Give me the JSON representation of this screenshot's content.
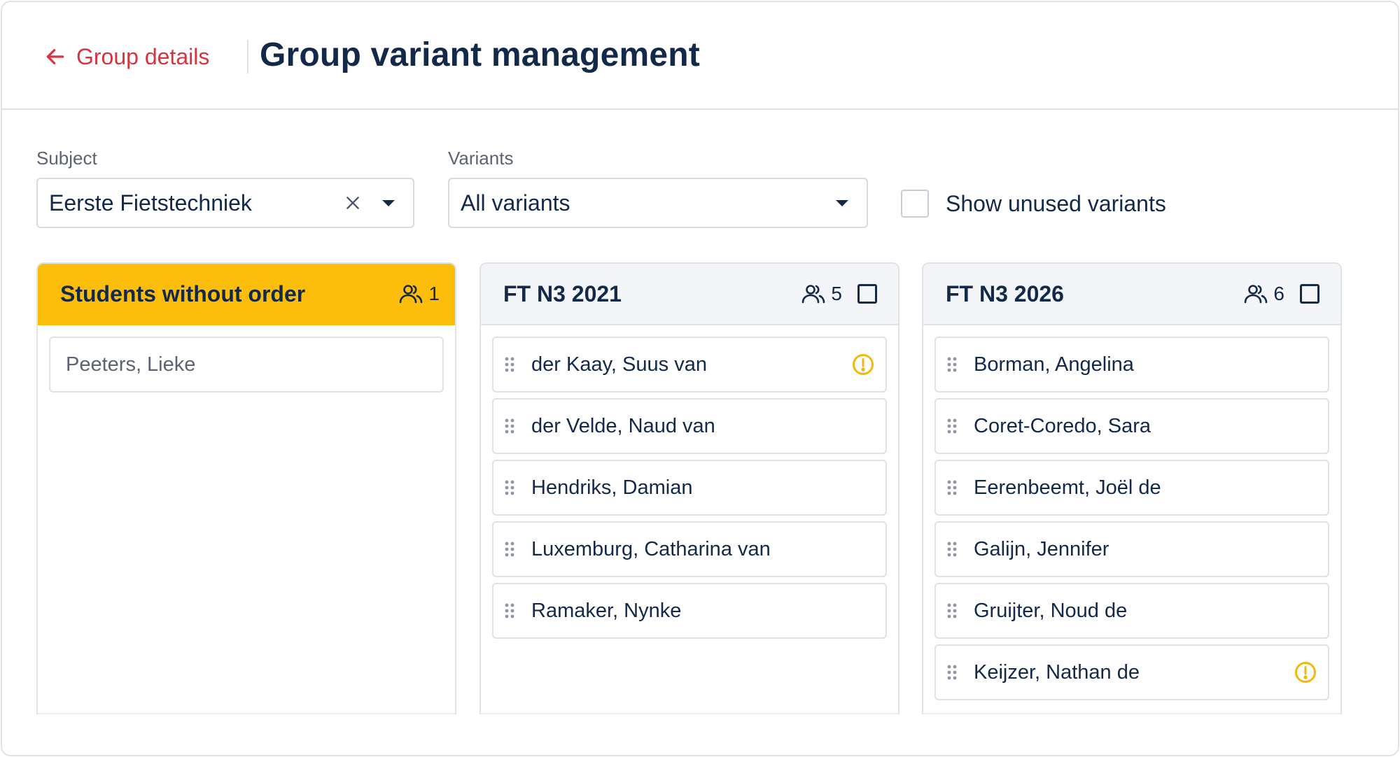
{
  "header": {
    "back_label": "Group details",
    "title": "Group variant management"
  },
  "filters": {
    "subject_label": "Subject",
    "subject_value": "Eerste Fietstechniek",
    "variants_label": "Variants",
    "variants_value": "All variants",
    "show_unused_label": "Show unused variants"
  },
  "columns": [
    {
      "title": "Students without order",
      "count": "1",
      "students": [
        {
          "name": "Peeters, Lieke"
        }
      ]
    },
    {
      "title": "FT N3 2021",
      "count": "5",
      "students": [
        {
          "name": "der Kaay, Suus van",
          "warning": true
        },
        {
          "name": "der Velde, Naud van"
        },
        {
          "name": "Hendriks, Damian"
        },
        {
          "name": "Luxemburg, Catharina van"
        },
        {
          "name": "Ramaker, Nynke"
        }
      ]
    },
    {
      "title": "FT N3 2026",
      "count": "6",
      "students": [
        {
          "name": "Borman, Angelina"
        },
        {
          "name": "Coret-Coredo, Sara"
        },
        {
          "name": "Eerenbeemt, Joël de"
        },
        {
          "name": "Galijn, Jennifer"
        },
        {
          "name": "Gruijter, Noud de"
        },
        {
          "name": "Keijzer, Nathan de",
          "warning": true
        }
      ]
    }
  ],
  "colors": {
    "accent_red": "#d8343f",
    "warning_yellow": "#fdbe0b",
    "text_navy": "#12294a",
    "border_gray": "#dfe2e7"
  },
  "icons": {
    "back": "arrow-left-icon",
    "clear": "close-icon",
    "caret": "caret-down-icon",
    "group": "users-icon",
    "drag": "drag-handle-icon",
    "alert": "alert-circle-icon"
  }
}
